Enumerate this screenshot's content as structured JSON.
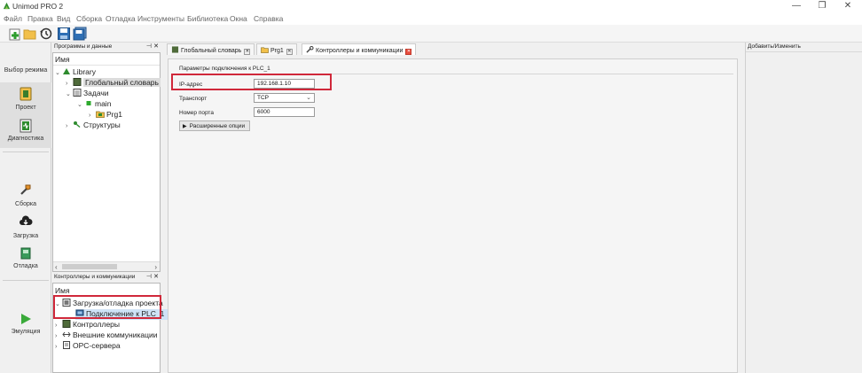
{
  "app": {
    "title": "Unimod PRO 2"
  },
  "window_controls": {
    "minimize": "—",
    "maximize": "❐",
    "close": "✕"
  },
  "menu": [
    "Файл",
    "Правка",
    "Вид",
    "Сборка",
    "Отладка",
    "Инструменты",
    "Библиотека",
    "Окна",
    "Справка"
  ],
  "toolbar": {
    "buttons": [
      "new-icon",
      "open-folder-icon",
      "history-icon",
      "save-icon",
      "save-all-icon"
    ]
  },
  "rail": {
    "mode_label": "Выбор режима",
    "items": [
      {
        "label": "Проект",
        "icon": "project-icon"
      },
      {
        "label": "Диагностика",
        "icon": "diagnostics-icon"
      },
      {
        "label": "Сборка",
        "icon": "build-icon"
      },
      {
        "label": "Загрузка",
        "icon": "download-icon"
      },
      {
        "label": "Отладка",
        "icon": "debug-icon"
      },
      {
        "label": "Эмуляция",
        "icon": "play-icon"
      }
    ]
  },
  "programs_panel": {
    "title": "Программы и данные",
    "pin": "⊣",
    "close": "✕",
    "column_header": "Имя",
    "tree": [
      {
        "label": "Library",
        "chevron": "⌄"
      },
      {
        "label": "Глобальный словарь",
        "chevron": "›"
      },
      {
        "label": "Задачи",
        "chevron": "⌄"
      },
      {
        "label": "main",
        "chevron": "⌄"
      },
      {
        "label": "Prg1",
        "chevron": "›"
      },
      {
        "label": "Структуры",
        "chevron": "›"
      }
    ]
  },
  "controllers_panel": {
    "title": "Контроллеры и коммуникации",
    "pin": "⊣",
    "close": "✕",
    "column_header": "Имя",
    "tree": [
      {
        "label": "Загрузка/отладка проекта",
        "chevron": "⌄"
      },
      {
        "label": "Подключение к PLC_1",
        "chevron": ""
      },
      {
        "label": "Контроллеры",
        "chevron": "›"
      },
      {
        "label": "Внешние коммуникации",
        "chevron": "›"
      },
      {
        "label": "OPC-сервера",
        "chevron": "›"
      }
    ]
  },
  "tabs": [
    {
      "label": "Глобальный словарь",
      "close": "✕"
    },
    {
      "label": "Prg1",
      "close": "✕"
    },
    {
      "label": "Контроллеры и коммуникации",
      "close": "✕"
    }
  ],
  "connection": {
    "section_title": "Параметры подключения к PLC_1",
    "ip_label": "IP-адрес",
    "ip_value": "192.168.1.10",
    "transport_label": "Транспорт",
    "transport_value": "TCP",
    "port_label": "Номер порта",
    "port_value": "6000",
    "advanced_button": "Расширенные опции"
  },
  "right_panel": {
    "title": "Добавить/Изменить"
  },
  "colors": {
    "accent_red": "#d0283a",
    "selection": "#cfe3f7"
  }
}
